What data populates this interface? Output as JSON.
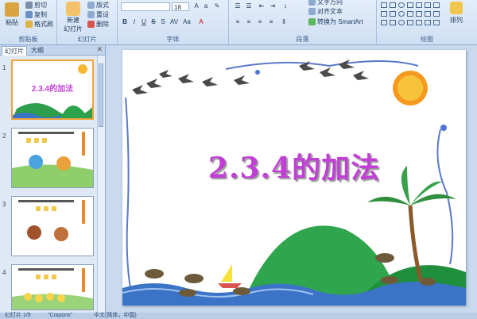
{
  "ribbon": {
    "clipboard": {
      "label": "剪贴板",
      "paste": "粘贴",
      "cut": "剪切",
      "copy": "复制",
      "format_painter": "格式刷"
    },
    "slides": {
      "label": "幻灯片",
      "new_slide": "新建",
      "new_slide_2": "幻灯片",
      "layout": "版式",
      "reset": "重设",
      "delete": "删除"
    },
    "font": {
      "label": "字体",
      "font_size": "18"
    },
    "paragraph": {
      "label": "段落",
      "text_direction": "文字方向",
      "align_text": "对齐文本",
      "smartart": "转换为 SmartArt"
    },
    "drawing": {
      "label": "绘图",
      "arrange": "排列"
    }
  },
  "panel": {
    "tab_slides": "幻灯片",
    "tab_outline": "大纲",
    "slides": [
      {
        "num": "1",
        "title": "2.3.4的加法"
      },
      {
        "num": "2",
        "title": ""
      },
      {
        "num": "3",
        "title": ""
      },
      {
        "num": "4",
        "title": ""
      }
    ]
  },
  "slide": {
    "title": "2.3.4的加法"
  },
  "status": {
    "slide_count": "幻灯片 1/9",
    "theme": "\"Crayons\"",
    "language": "中文(简体，中国)"
  },
  "colors": {
    "title": "#c13fd6",
    "ribbon": "#dce8f7",
    "accent": "#f2a33a"
  }
}
